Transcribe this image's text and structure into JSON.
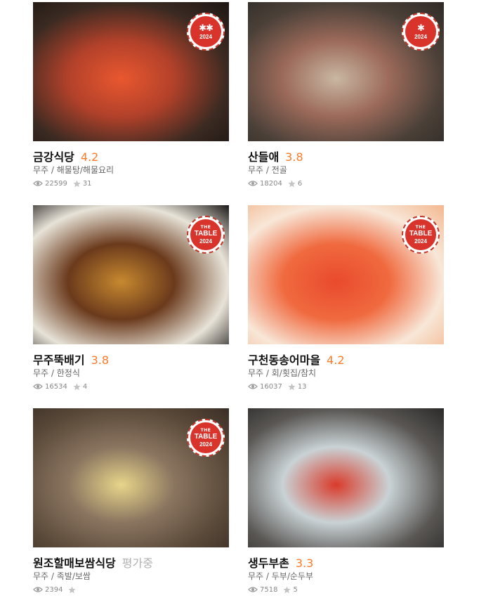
{
  "restaurants": [
    {
      "name": "금강식당",
      "rating": "4.2",
      "rating_pending": false,
      "region": "무주",
      "category": "해물탕/해물요리",
      "views": "22599",
      "favorites": "31",
      "badge": {
        "type": "michelin",
        "mark": "✱✱",
        "year": "2024"
      },
      "colors": [
        "#3a2a22",
        "#b2412a",
        "#e9572f",
        "#1d1512"
      ]
    },
    {
      "name": "산들애",
      "rating": "3.8",
      "rating_pending": false,
      "region": "무주",
      "category": "전골",
      "views": "18204",
      "favorites": "6",
      "badge": {
        "type": "michelin",
        "mark": "✱",
        "year": "2024"
      },
      "colors": [
        "#4a4038",
        "#9c6a5a",
        "#c9b7a3",
        "#2f2925"
      ]
    },
    {
      "name": "무주뚝배기",
      "rating": "3.8",
      "rating_pending": false,
      "region": "무주",
      "category": "한정식",
      "views": "16534",
      "favorites": "4",
      "badge": {
        "type": "thetable",
        "the": "THE",
        "table": "TABLE",
        "year": "2024"
      },
      "colors": [
        "#e7e3d8",
        "#6b3a1c",
        "#c7892f",
        "#1b1716"
      ]
    },
    {
      "name": "구천동송어마을",
      "rating": "4.2",
      "rating_pending": false,
      "region": "무주",
      "category": "회/횟집/참치",
      "views": "16037",
      "favorites": "13",
      "badge": {
        "type": "thetable",
        "the": "THE",
        "table": "TABLE",
        "year": "2024"
      },
      "colors": [
        "#f8e7d8",
        "#f06a3f",
        "#e94a2c",
        "#f3b78f"
      ]
    },
    {
      "name": "원조할매보쌈식당",
      "rating": "평가중",
      "rating_pending": true,
      "region": "무주",
      "category": "족발/보쌈",
      "views": "2394",
      "favorites": "",
      "badge": {
        "type": "thetable",
        "the": "THE",
        "table": "TABLE",
        "year": "2024"
      },
      "colors": [
        "#5b4a3a",
        "#8a7560",
        "#e8d58a",
        "#3a2e25"
      ]
    },
    {
      "name": "생두부촌",
      "rating": "3.3",
      "rating_pending": false,
      "region": "무주",
      "category": "두부/순두부",
      "views": "7518",
      "favorites": "5",
      "badge": null,
      "colors": [
        "#595653",
        "#c9d2d5",
        "#d93b2b",
        "#2b2a29"
      ]
    }
  ],
  "icons": {
    "views": "eye-icon",
    "favorites": "star-icon"
  }
}
